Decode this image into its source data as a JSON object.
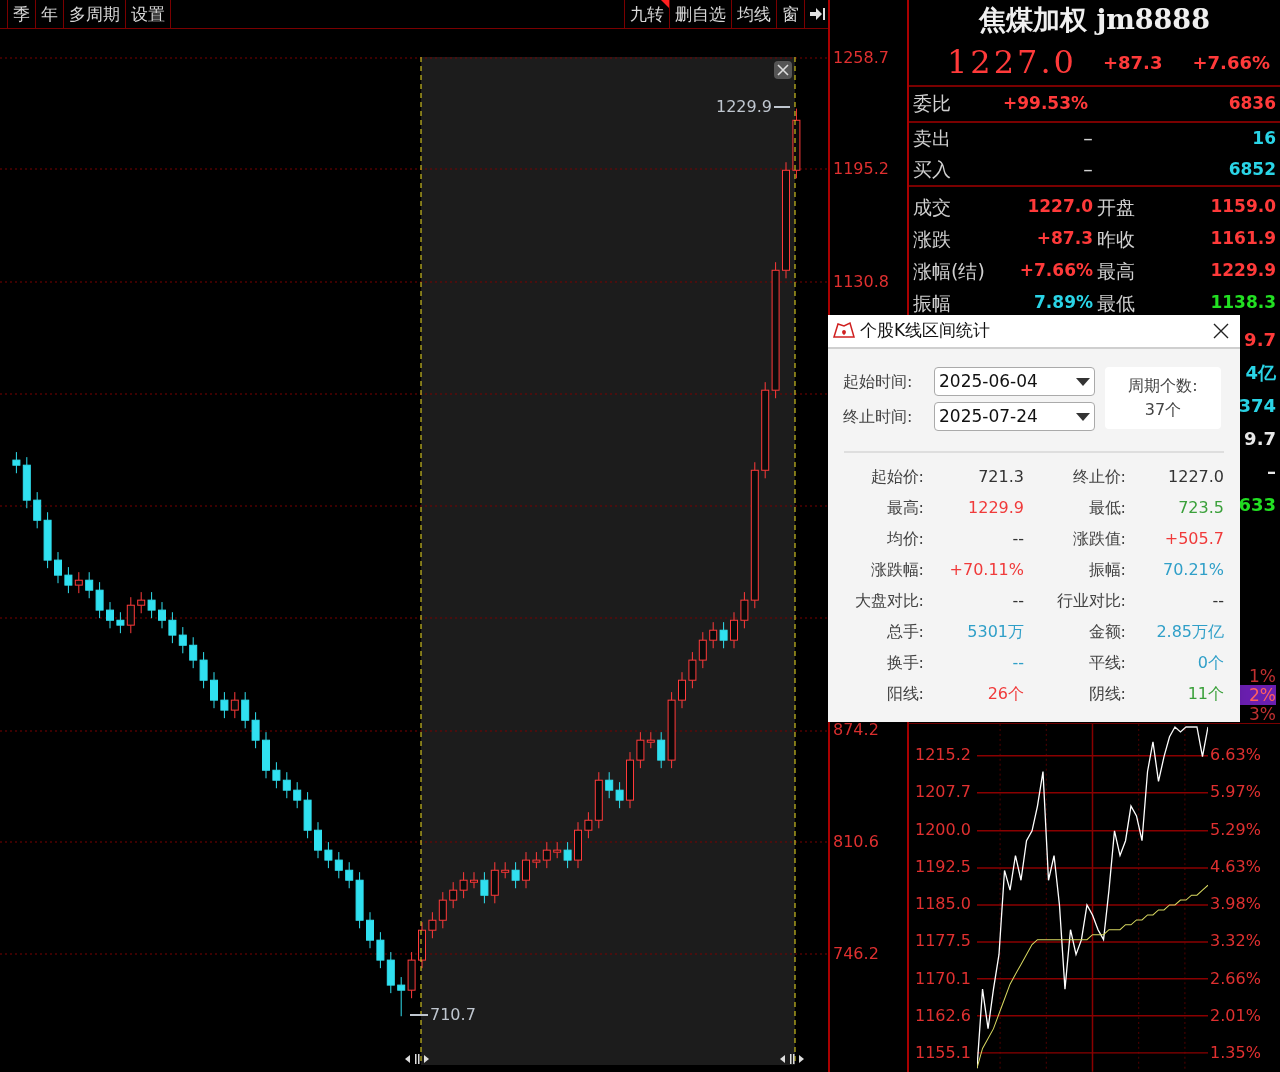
{
  "toolbar": {
    "left": [
      "季",
      "年",
      "多周期",
      "设置"
    ],
    "right": [
      {
        "label": "九转",
        "flag": true
      },
      {
        "label": "删自选",
        "flag": false
      },
      {
        "label": "均线",
        "flag": false
      },
      {
        "label": "窗",
        "flag": false
      }
    ]
  },
  "kline": {
    "high_label": "1229.9",
    "low_label": "710.7",
    "chart_data": {
      "type": "candlestick",
      "grid": true,
      "ylim": [
        678.8,
        1292.0
      ],
      "yticks": [
        {
          "value": 1258.7,
          "label": "1258.7"
        },
        {
          "value": 1195.2,
          "label": "1195.2"
        },
        {
          "value": 1130.8,
          "label": "1130.8"
        },
        {
          "value": 874.2,
          "label": "874.2"
        },
        {
          "value": 810.6,
          "label": "810.6"
        },
        {
          "value": 746.2,
          "label": "746.2"
        }
      ],
      "ohlc": [
        [
          1028.8,
          1033.4,
          1021.3,
          1025.9
        ],
        [
          1025.9,
          1030.5,
          1001.3,
          1005.9
        ],
        [
          1005.9,
          1010.5,
          989.8,
          994.4
        ],
        [
          994.4,
          999.0,
          967.0,
          971.6
        ],
        [
          971.6,
          976.2,
          958.4,
          963.0
        ],
        [
          963.0,
          967.6,
          952.7,
          957.3
        ],
        [
          957.3,
          964.7,
          952.7,
          960.1
        ],
        [
          960.1,
          964.7,
          949.8,
          954.4
        ],
        [
          954.4,
          959.0,
          938.4,
          943.0
        ],
        [
          943.0,
          947.6,
          932.6,
          937.2
        ],
        [
          937.2,
          941.8,
          929.8,
          934.4
        ],
        [
          934.4,
          950.4,
          929.8,
          945.8
        ],
        [
          945.8,
          953.3,
          941.2,
          948.7
        ],
        [
          948.7,
          953.3,
          938.4,
          943.0
        ],
        [
          943.0,
          947.6,
          932.6,
          937.2
        ],
        [
          937.2,
          941.8,
          924.1,
          928.7
        ],
        [
          928.7,
          933.3,
          918.3,
          922.9
        ],
        [
          922.9,
          927.5,
          909.8,
          914.4
        ],
        [
          914.4,
          919.0,
          898.3,
          902.9
        ],
        [
          902.9,
          907.5,
          886.9,
          891.5
        ],
        [
          891.5,
          896.1,
          881.2,
          885.8
        ],
        [
          885.8,
          896.1,
          881.2,
          891.5
        ],
        [
          891.5,
          896.1,
          875.4,
          880.0
        ],
        [
          880.0,
          884.6,
          864.0,
          868.6
        ],
        [
          868.6,
          873.2,
          846.8,
          851.4
        ],
        [
          851.4,
          856.0,
          841.1,
          845.7
        ],
        [
          845.7,
          850.3,
          835.4,
          840.0
        ],
        [
          840.0,
          844.6,
          829.7,
          834.3
        ],
        [
          834.3,
          838.9,
          812.5,
          817.1
        ],
        [
          817.1,
          821.7,
          801.1,
          805.7
        ],
        [
          805.7,
          810.3,
          795.4,
          800.0
        ],
        [
          800.0,
          804.6,
          789.6,
          794.2
        ],
        [
          794.2,
          798.8,
          783.9,
          788.5
        ],
        [
          788.5,
          793.1,
          761.0,
          765.6
        ],
        [
          765.6,
          770.2,
          749.6,
          754.2
        ],
        [
          754.2,
          758.8,
          738.2,
          742.8
        ],
        [
          742.8,
          747.4,
          723.9,
          728.5
        ],
        [
          728.5,
          733.1,
          710.7,
          725.6
        ],
        [
          725.6,
          747.4,
          721.0,
          742.8
        ],
        [
          742.8,
          764.5,
          738.2,
          759.9
        ],
        [
          759.9,
          770.2,
          755.3,
          765.6
        ],
        [
          765.6,
          781.7,
          761.0,
          777.1
        ],
        [
          777.1,
          787.4,
          772.5,
          782.8
        ],
        [
          782.8,
          793.1,
          778.2,
          788.5
        ],
        [
          788.5,
          793.1,
          783.9,
          788.5
        ],
        [
          788.5,
          793.1,
          775.3,
          779.9
        ],
        [
          779.9,
          798.8,
          775.3,
          794.2
        ],
        [
          794.2,
          798.8,
          789.6,
          794.2
        ],
        [
          794.2,
          798.8,
          783.9,
          788.5
        ],
        [
          788.5,
          804.6,
          783.9,
          800.0
        ],
        [
          800.0,
          804.6,
          795.4,
          800.0
        ],
        [
          800.0,
          810.3,
          795.4,
          805.7
        ],
        [
          805.7,
          810.3,
          801.1,
          805.7
        ],
        [
          805.7,
          810.3,
          795.4,
          800.0
        ],
        [
          800.0,
          821.7,
          795.4,
          817.1
        ],
        [
          817.1,
          827.4,
          812.5,
          822.8
        ],
        [
          822.8,
          850.3,
          818.2,
          845.7
        ],
        [
          845.7,
          850.3,
          835.4,
          840.0
        ],
        [
          840.0,
          844.6,
          829.7,
          834.3
        ],
        [
          834.3,
          861.8,
          829.7,
          857.2
        ],
        [
          857.2,
          873.2,
          852.6,
          868.6
        ],
        [
          868.6,
          873.2,
          864.0,
          868.6
        ],
        [
          868.6,
          873.2,
          852.6,
          857.2
        ],
        [
          857.2,
          896.1,
          852.6,
          891.5
        ],
        [
          891.5,
          907.5,
          886.9,
          902.9
        ],
        [
          902.9,
          919.0,
          898.3,
          914.4
        ],
        [
          914.4,
          930.4,
          909.8,
          925.8
        ],
        [
          925.8,
          936.1,
          921.2,
          931.5
        ],
        [
          931.5,
          936.1,
          921.2,
          925.8
        ],
        [
          925.8,
          941.8,
          921.2,
          937.2
        ],
        [
          937.2,
          953.3,
          932.6,
          948.7
        ],
        [
          948.7,
          1027.6,
          944.1,
          1023.0
        ],
        [
          1023.0,
          1073.4,
          1018.4,
          1068.8
        ],
        [
          1068.8,
          1142.0,
          1064.2,
          1137.4
        ],
        [
          1137.4,
          1199.2,
          1132.8,
          1194.6
        ],
        [
          1194.6,
          1229.9,
          1190.0,
          1223.2
        ]
      ]
    }
  },
  "quote": {
    "title": "焦煤加权 jm8888",
    "price": "1227.0",
    "change": "+87.3",
    "change_pct": "+7.66%",
    "ratio": {
      "label": "委比",
      "value": "+99.53%",
      "volume": "6836"
    },
    "book": [
      {
        "label": "卖出",
        "price": "–",
        "volume": "16"
      },
      {
        "label": "买入",
        "price": "–",
        "volume": "6852"
      }
    ],
    "stats": [
      {
        "cells": [
          {
            "label": "成交",
            "value": "1227.0",
            "kind": "up"
          },
          {
            "label": "开盘",
            "value": "1159.0",
            "kind": "up"
          }
        ]
      },
      {
        "cells": [
          {
            "label": "涨跌",
            "value": "+87.3",
            "kind": "up"
          },
          {
            "label": "昨收",
            "value": "1161.9",
            "kind": "up"
          }
        ]
      },
      {
        "cells": [
          {
            "label": "涨幅(结)",
            "value": "+7.66%",
            "kind": "up"
          },
          {
            "label": "最高",
            "value": "1229.9",
            "kind": "up"
          }
        ]
      },
      {
        "cells": [
          {
            "label": "振幅",
            "value": "7.89%",
            "kind": "info"
          },
          {
            "label": "最低",
            "value": "1138.3",
            "kind": "down"
          }
        ]
      }
    ],
    "fragments": [
      {
        "text": "9.7",
        "kind": "up"
      },
      {
        "text": "4亿",
        "kind": "info"
      },
      {
        "text": "374",
        "kind": "info"
      },
      {
        "text": "9.7",
        "kind": "flat"
      },
      {
        "text": "–",
        "kind": "flat"
      },
      {
        "text": "633",
        "kind": "down"
      }
    ],
    "pct_fragments": [
      {
        "text": "1%",
        "highlight": false
      },
      {
        "text": "2%",
        "highlight": true
      },
      {
        "text": "3%",
        "highlight": false
      }
    ]
  },
  "intraday": {
    "chart_data": {
      "type": "line",
      "grid": true,
      "ylim": [
        1151.3,
        1221.6
      ],
      "yticks": [
        {
          "value": 1215.2,
          "label": "1215.2"
        },
        {
          "value": 1207.7,
          "label": "1207.7"
        },
        {
          "value": 1200.0,
          "label": "1200.0"
        },
        {
          "value": 1192.5,
          "label": "1192.5"
        },
        {
          "value": 1185.0,
          "label": "1185.0"
        },
        {
          "value": 1177.5,
          "label": "1177.5"
        },
        {
          "value": 1170.1,
          "label": "1170.1"
        },
        {
          "value": 1162.6,
          "label": "1162.6"
        },
        {
          "value": 1155.1,
          "label": "1155.1"
        }
      ],
      "series": [
        {
          "color": "#ffffff",
          "values": [
            1152,
            1168,
            1160,
            1168,
            1175,
            1192,
            1188,
            1195,
            1190,
            1198,
            1200,
            1205,
            1212,
            1190,
            1195,
            1185,
            1168,
            1180,
            1175,
            1178,
            1185,
            1183,
            1180,
            1178,
            1188,
            1200,
            1195,
            1198,
            1205,
            1203,
            1198,
            1212,
            1218,
            1210,
            1215,
            1219,
            1221,
            1220,
            1221,
            1221,
            1221,
            1215,
            1221
          ]
        },
        {
          "color": "#d8d860",
          "values": [
            1152,
            1156,
            1158,
            1160,
            1163,
            1166,
            1169,
            1171,
            1173,
            1175,
            1177,
            1178,
            1178,
            1178,
            1178,
            1178,
            1178,
            1178,
            1178,
            1178,
            1178,
            1179,
            1179,
            1179,
            1180,
            1180,
            1180,
            1181,
            1181,
            1182,
            1182,
            1183,
            1183,
            1184,
            1184,
            1185,
            1185,
            1186,
            1186,
            1187,
            1187,
            1188,
            1189
          ]
        }
      ]
    },
    "pcts": [
      "6.63%",
      "5.97%",
      "5.29%",
      "4.63%",
      "3.98%",
      "3.32%",
      "2.66%",
      "2.01%",
      "1.35%"
    ]
  },
  "dialog": {
    "title": "个股K线区间统计",
    "start_label": "起始时间:",
    "start_value": "2025-06-04",
    "end_label": "终止时间:",
    "end_value": "2025-07-24",
    "count_label": "周期个数:",
    "count_value": "37个",
    "rows": [
      {
        "cells": [
          {
            "label": "起始价:",
            "value": "721.3",
            "kind": "flat"
          },
          {
            "label": "终止价:",
            "value": "1227.0",
            "kind": "flat"
          }
        ]
      },
      {
        "cells": [
          {
            "label": "最高:",
            "value": "1229.9",
            "kind": "up"
          },
          {
            "label": "最低:",
            "value": "723.5",
            "kind": "down"
          }
        ]
      },
      {
        "cells": [
          {
            "label": "均价:",
            "value": "--",
            "kind": "flat"
          },
          {
            "label": "涨跌值:",
            "value": "+505.7",
            "kind": "up"
          }
        ]
      },
      {
        "cells": [
          {
            "label": "涨跌幅:",
            "value": "+70.11%",
            "kind": "up"
          },
          {
            "label": "振幅:",
            "value": "70.21%",
            "kind": "info"
          }
        ]
      },
      {
        "cells": [
          {
            "label": "大盘对比:",
            "value": "--",
            "kind": "flat"
          },
          {
            "label": "行业对比:",
            "value": "--",
            "kind": "flat"
          }
        ]
      },
      {
        "cells": [
          {
            "label": "总手:",
            "value": "5301万",
            "kind": "info"
          },
          {
            "label": "金额:",
            "value": "2.85万亿",
            "kind": "info"
          }
        ]
      },
      {
        "cells": [
          {
            "label": "换手:",
            "value": "--",
            "kind": "info"
          },
          {
            "label": "平线:",
            "value": "0个",
            "kind": "info"
          }
        ]
      },
      {
        "cells": [
          {
            "label": "阳线:",
            "value": "26个",
            "kind": "up"
          },
          {
            "label": "阴线:",
            "value": "11个",
            "kind": "down"
          }
        ]
      }
    ]
  }
}
